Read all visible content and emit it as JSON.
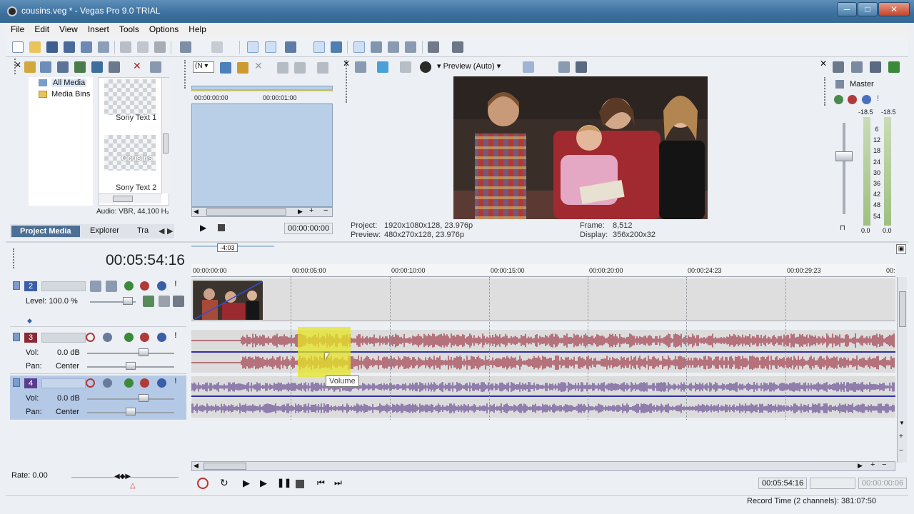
{
  "window": {
    "title": "cousins.veg * - Vegas Pro 9.0 TRIAL",
    "min": "─",
    "max": "□",
    "close": "✕"
  },
  "menu": [
    "File",
    "Edit",
    "View",
    "Insert",
    "Tools",
    "Options",
    "Help"
  ],
  "explorer": {
    "tree": [
      "All Media",
      "Media Bins"
    ],
    "thumbs": [
      "Sony Text 1",
      "Sony Text 2"
    ],
    "thumb_overlay": "Cousins",
    "audio_info": "Audio: VBR, 44,100 H₂",
    "tabs": [
      "Project Media",
      "Explorer",
      "Tra"
    ]
  },
  "trimmer": {
    "ruler": [
      "00:00:00:00",
      "00:00:01:00"
    ],
    "timecode": "00:00:00:00",
    "dropdown": "(N"
  },
  "preview": {
    "quality": "Preview (Auto)",
    "project_label": "Project:",
    "project_value": "1920x1080x128, 23.976p",
    "preview_label": "Preview:",
    "preview_value": "480x270x128, 23.976p",
    "frame_label": "Frame:",
    "frame_value": "8,512",
    "display_label": "Display:",
    "display_value": "356x200x32"
  },
  "master": {
    "label": "Master",
    "peak_l": "-18.5",
    "peak_r": "-18.5",
    "scale": [
      "6",
      "12",
      "18",
      "24",
      "30",
      "36",
      "42",
      "48",
      "54"
    ],
    "val_l": "0.0",
    "val_r": "0.0"
  },
  "timeline": {
    "cursor": "00:05:54:16",
    "region_marker": "-4:03",
    "ruler": [
      "00:00:00:00",
      "00:00:05:00",
      "00:00:10:00",
      "00:00:15:00",
      "00:00:20:00",
      "00:00:24:23",
      "00:00:29:23",
      "00:"
    ],
    "tooltip": "Volume"
  },
  "tracks": [
    {
      "num": "2",
      "type": "video",
      "level_label": "Level: 100.0 %",
      "color": "#3a5ea8"
    },
    {
      "num": "3",
      "type": "audio",
      "vol_label": "Vol:",
      "vol": "0.0 dB",
      "pan_label": "Pan:",
      "pan": "Center",
      "color": "#8a2a36",
      "wave_color": "#9b2c3c"
    },
    {
      "num": "4",
      "type": "audio",
      "vol_label": "Vol:",
      "vol": "0.0 dB",
      "pan_label": "Pan:",
      "pan": "Center",
      "color": "#5a3d8e",
      "wave_color": "#5c3f8c"
    }
  ],
  "transport": {
    "rate": "Rate: 0.00",
    "position": "00:05:54:16",
    "selection": "00:00:00:06"
  },
  "status": {
    "record_time": "Record Time (2 channels): 381:07:50"
  }
}
